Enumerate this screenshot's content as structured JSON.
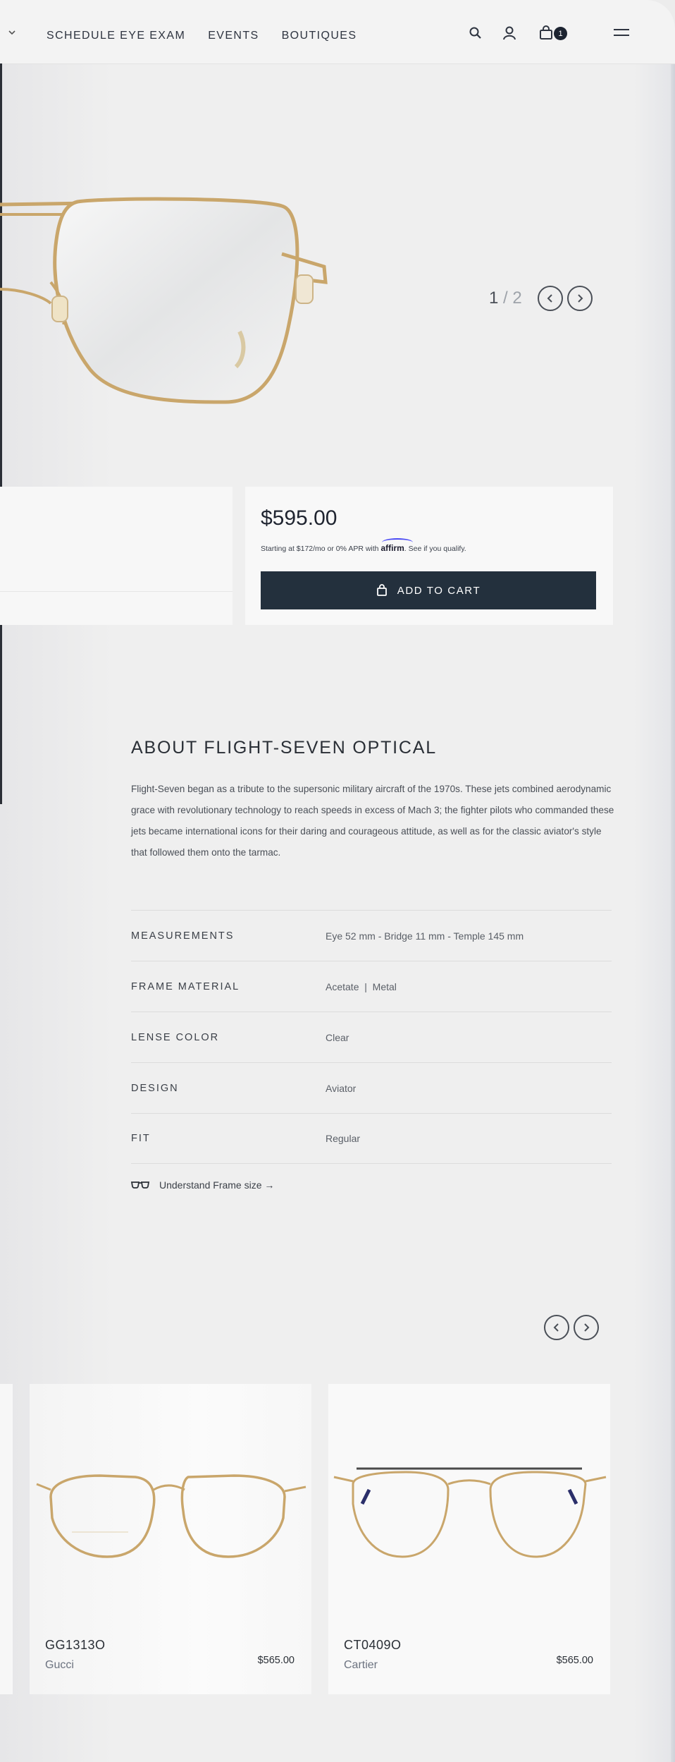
{
  "header": {
    "nav": [
      "Schedule Eye Exam",
      "Events",
      "Boutiques"
    ],
    "icons": [
      "chevron-down-icon",
      "search-icon",
      "account-icon",
      "bag-icon",
      "menu-icon"
    ],
    "cart_count": "1"
  },
  "gallery": {
    "current": "1",
    "total": "2",
    "separator": "/"
  },
  "purchase": {
    "price": "$595.00",
    "affirm_prefix": "Starting at $172/mo or 0% APR with",
    "affirm_brand": "affirm",
    "affirm_suffix": "See if you qualify.",
    "add_to_cart_label": "ADD TO CART"
  },
  "about": {
    "title": "About Flight-Seven Optical",
    "body": "Flight-Seven began as a tribute to the supersonic military aircraft of the 1970s. These jets combined aerodynamic grace with revolutionary technology to reach speeds in excess of Mach 3; the fighter pilots who commanded these jets became international icons for their daring and courageous attitude, as well as for the classic aviator's style that followed them onto the tarmac."
  },
  "specs": [
    {
      "label": "Measurements",
      "value": "Eye 52 mm - Bridge 11 mm - Temple 145 mm"
    },
    {
      "label": "Frame Material",
      "value": "Acetate  |  Metal"
    },
    {
      "label": "Lense Color",
      "value": "Clear"
    },
    {
      "label": "Design",
      "value": "Aviator"
    },
    {
      "label": "Fit",
      "value": "Regular"
    }
  ],
  "frame_size_link": "Understand Frame size →",
  "recommendations": [
    {
      "model": "GG1313O",
      "brand": "Gucci",
      "price": "$565.00"
    },
    {
      "model": "CT0409O",
      "brand": "Cartier",
      "price": "$565.00"
    }
  ],
  "colors": {
    "primary_button": "#23303d",
    "frame_gold": "#c9a66b",
    "background": "#efefef"
  }
}
